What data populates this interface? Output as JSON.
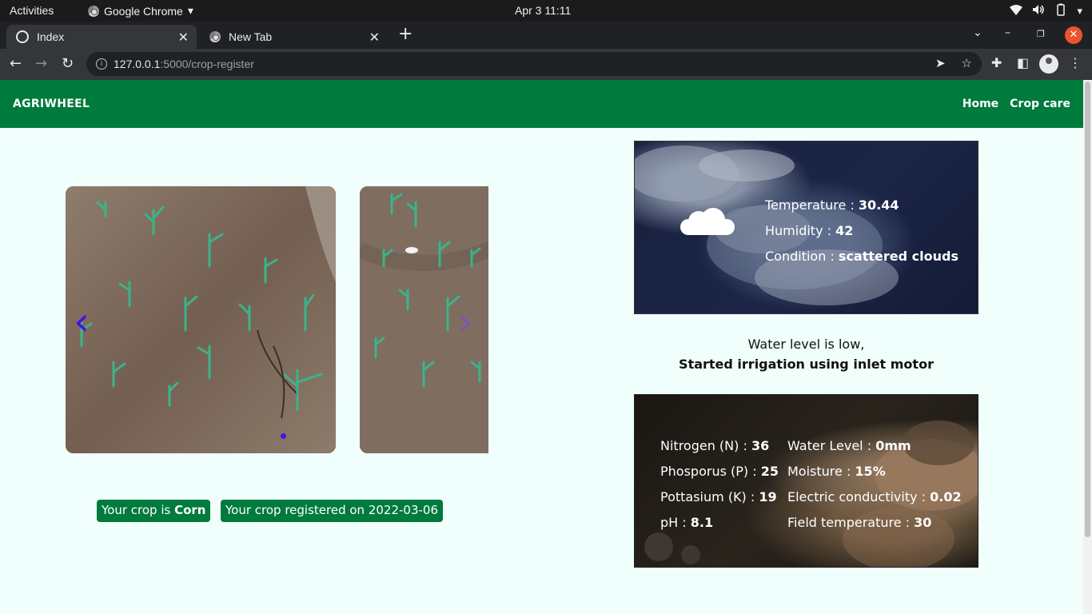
{
  "os_bar": {
    "activities": "Activities",
    "app_name": "Google Chrome",
    "clock": "Apr 3  11:11"
  },
  "browser": {
    "tabs": [
      {
        "title": "Index",
        "active": true
      },
      {
        "title": "New Tab",
        "active": false
      }
    ],
    "url_host": "127.0.0.1",
    "url_path": ":5000/crop-register"
  },
  "navbar": {
    "brand": "AGRIWHEEL",
    "links": [
      "Home",
      "Crop care"
    ]
  },
  "crop": {
    "label_prefix": "Your crop is ",
    "name": "Corn",
    "registered": "Your crop registered on 2022-03-06"
  },
  "weather": {
    "temperature_label": "Temperature : ",
    "temperature": "30.44",
    "humidity_label": "Humidity : ",
    "humidity": "42",
    "condition_label": "Condition : ",
    "condition": "scattered clouds"
  },
  "water_message": {
    "line1": "Water level is low,",
    "line2": "Started irrigation using inlet motor"
  },
  "soil": {
    "left": [
      {
        "label": "Nitrogen (N) : ",
        "value": "36"
      },
      {
        "label": "Phosporus (P) : ",
        "value": "25"
      },
      {
        "label": "Pottasium (K) : ",
        "value": "19"
      },
      {
        "label": "pH : ",
        "value": "8.1"
      }
    ],
    "right": [
      {
        "label": "Water Level : ",
        "value": "0mm"
      },
      {
        "label": "Moisture : ",
        "value": "15%"
      },
      {
        "label": "Electric conductivity : ",
        "value": "0.02"
      },
      {
        "label": "Field temperature : ",
        "value": "30"
      }
    ]
  },
  "colors": {
    "brand_green": "#007a3d",
    "page_bg": "#f0fffb",
    "carousel_arrow": "#4a0ee6"
  }
}
